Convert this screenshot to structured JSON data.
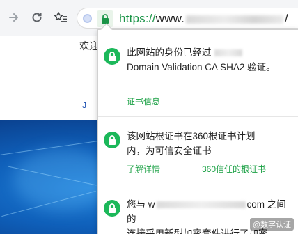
{
  "toolbar": {
    "url_protocol": "https://",
    "url_host_prefix": "www.",
    "url_suffix": "/"
  },
  "page": {
    "welcome_text": "欢迎",
    "logo_fragment": "J",
    "banner_color": "#0f5fb9"
  },
  "popup": {
    "identity": {
      "text_line1": "此网站的身份已经过",
      "text_rest": "Domain Validation CA SHA2 验证。",
      "link": "证书信息"
    },
    "root_cert": {
      "text": "该网站根证书在360根证书计划内，为可信安全证书",
      "link_learn": "了解详情",
      "link_trusted": "360信任的根证书"
    },
    "encryption": {
      "text_prefix": "您与 w",
      "text_mid": "com 之间的",
      "text_rest": "连接采用新型加密套件进行了加密"
    },
    "watermark": "@数字认证"
  },
  "colors": {
    "secure_green": "#1cb85a",
    "link_green": "#19a043",
    "url_green": "#1a9447"
  }
}
